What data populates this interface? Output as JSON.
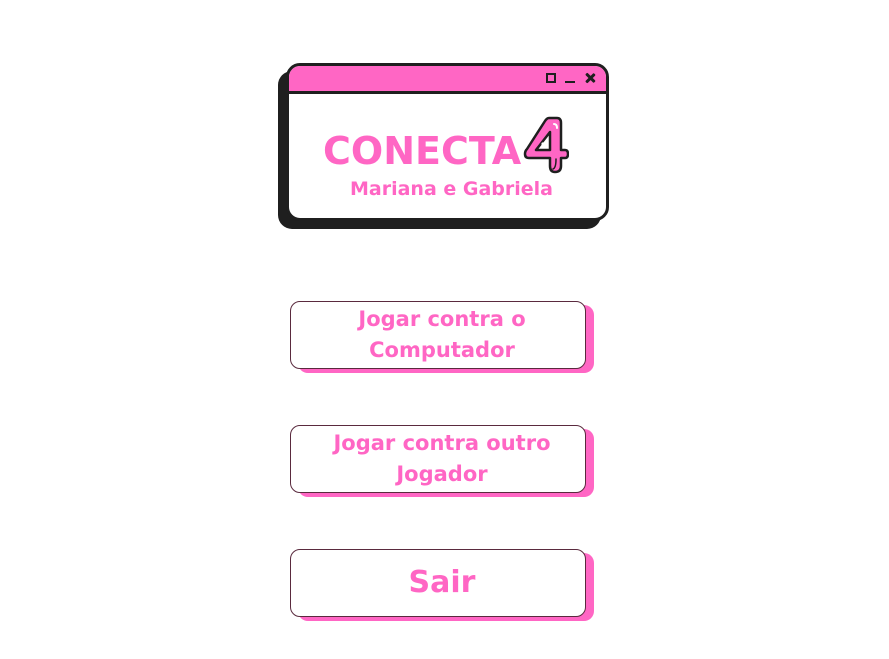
{
  "app": {
    "title_word": "CONECTA",
    "title_number": "4",
    "subtitle": "Mariana e Gabriela"
  },
  "window_controls": [
    "maximize-icon",
    "minimize-icon",
    "close-icon"
  ],
  "menu": {
    "play_vs_computer": "Jogar contra o Computador",
    "play_vs_player": "Jogar contra outro Jogador",
    "exit": "Sair"
  },
  "colors": {
    "accent": "#ff66c4",
    "outline": "#1f1f1f",
    "background": "#ffffff"
  }
}
